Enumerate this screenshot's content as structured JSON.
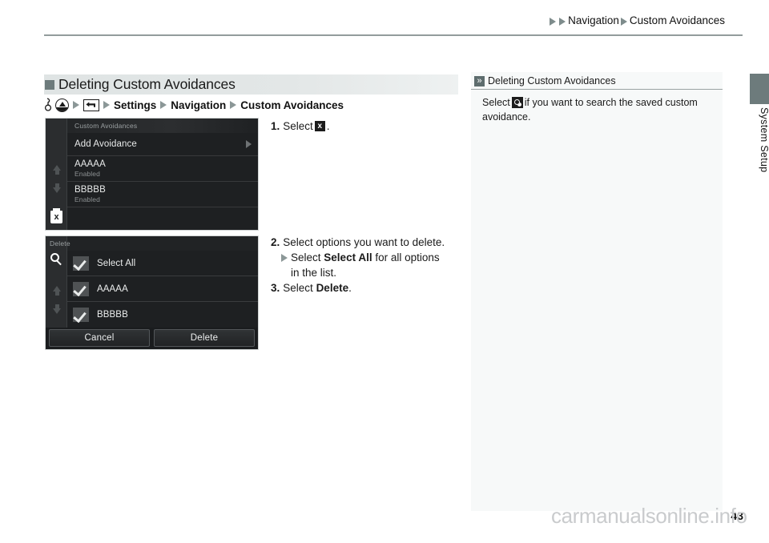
{
  "header": {
    "breadcrumb": [
      "Navigation",
      "Custom Avoidances"
    ]
  },
  "side_tab": {
    "label": "System Setup"
  },
  "section": {
    "title": "Deleting Custom Avoidances",
    "path": {
      "icons": [
        "finger-hook-icon",
        "home-icon",
        "back-icon"
      ],
      "items": [
        "Settings",
        "Navigation",
        "Custom Avoidances"
      ]
    }
  },
  "steps": {
    "step1": {
      "num": "1.",
      "text_before": "Select",
      "icon": "trash-delete-icon",
      "text_after": "."
    },
    "step2": {
      "num": "2.",
      "text": "Select options you want to delete.",
      "sub_before": "Select",
      "sub_bold": "Select All",
      "sub_after": "for all options",
      "sub_line2": "in the list."
    },
    "step3": {
      "num": "3.",
      "text_before": "Select",
      "bold": "Delete",
      "text_after": "."
    }
  },
  "screenshot1": {
    "title": "Custom Avoidances",
    "rail_icons": [
      "scroll-up-icon",
      "scroll-down-icon",
      "trash-delete-icon"
    ],
    "rows": [
      {
        "label": "Add Avoidance",
        "sub": "",
        "arrow": true
      },
      {
        "label": "AAAAA",
        "sub": "Enabled",
        "arrow": false
      },
      {
        "label": "BBBBB",
        "sub": "Enabled",
        "arrow": false
      }
    ]
  },
  "screenshot2": {
    "title": "Delete",
    "rail_icons": [
      "search-icon",
      "scroll-up-icon",
      "scroll-down-icon"
    ],
    "rows": [
      {
        "label": "Select All",
        "checked": true
      },
      {
        "label": "AAAAA",
        "checked": true
      },
      {
        "label": "BBBBB",
        "checked": true
      }
    ],
    "buttons": {
      "cancel": "Cancel",
      "delete": "Delete"
    }
  },
  "note": {
    "title": "Deleting Custom Avoidances",
    "body_before": "Select",
    "icon": "search-icon",
    "body_after": "if you want to search the saved custom avoidance."
  },
  "footer": {
    "page_number": "43",
    "watermark": "carmanualsonline.info"
  },
  "colors": {
    "accent": "#6d7b7c",
    "heading_bar": "#dfe4e4",
    "screen_bg": "#1e2022",
    "note_bg": "#f7f9f9"
  }
}
